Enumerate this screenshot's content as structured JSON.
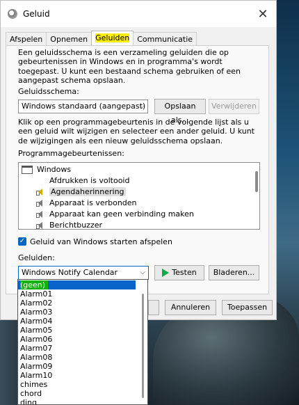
{
  "window": {
    "title": "Geluid"
  },
  "tabs": [
    {
      "label": "Afspelen"
    },
    {
      "label": "Opnemen"
    },
    {
      "label": "Geluiden"
    },
    {
      "label": "Communicatie"
    }
  ],
  "intro_text": "Een geluidsschema is een verzameling geluiden die op gebeurtenissen in Windows en in programma's wordt toegepast. U kunt een bestaand schema gebruiken of een aangepast schema opslaan.",
  "scheme": {
    "label": "Geluidsschema:",
    "selected": "Windows standaard (aangepast)",
    "save_label": "Opslaan als...",
    "delete_label": "Verwijderen"
  },
  "events_help": "Klik op een programmagebeurtenis in de volgende lijst als u een geluid wilt wijzigen en selecteer een ander geluid. U kunt de wijzigingen als een nieuw geluidsschema opslaan.",
  "events_label": "Programmagebeurtenissen:",
  "events": [
    {
      "label": "Windows"
    },
    {
      "label": "Afdrukken is voltooid"
    },
    {
      "label": "Agendaherinnering"
    },
    {
      "label": "Apparaat is verbonden"
    },
    {
      "label": "Apparaat kan geen verbinding maken"
    },
    {
      "label": "Berichtbuzzer"
    }
  ],
  "startup_sound_label": "Geluid van Windows starten afspelen",
  "sounds_label": "Geluiden:",
  "sound_selected": "Windows Notify Calendar",
  "test_label": "Testen",
  "browse_label": "Bladeren...",
  "cancel_label": "Annuleren",
  "apply_label": "Toepassen",
  "dropdown_options": [
    "(geen)",
    "Alarm01",
    "Alarm02",
    "Alarm03",
    "Alarm04",
    "Alarm05",
    "Alarm06",
    "Alarm07",
    "Alarm08",
    "Alarm09",
    "Alarm10",
    "chimes",
    "chord",
    "ding"
  ]
}
